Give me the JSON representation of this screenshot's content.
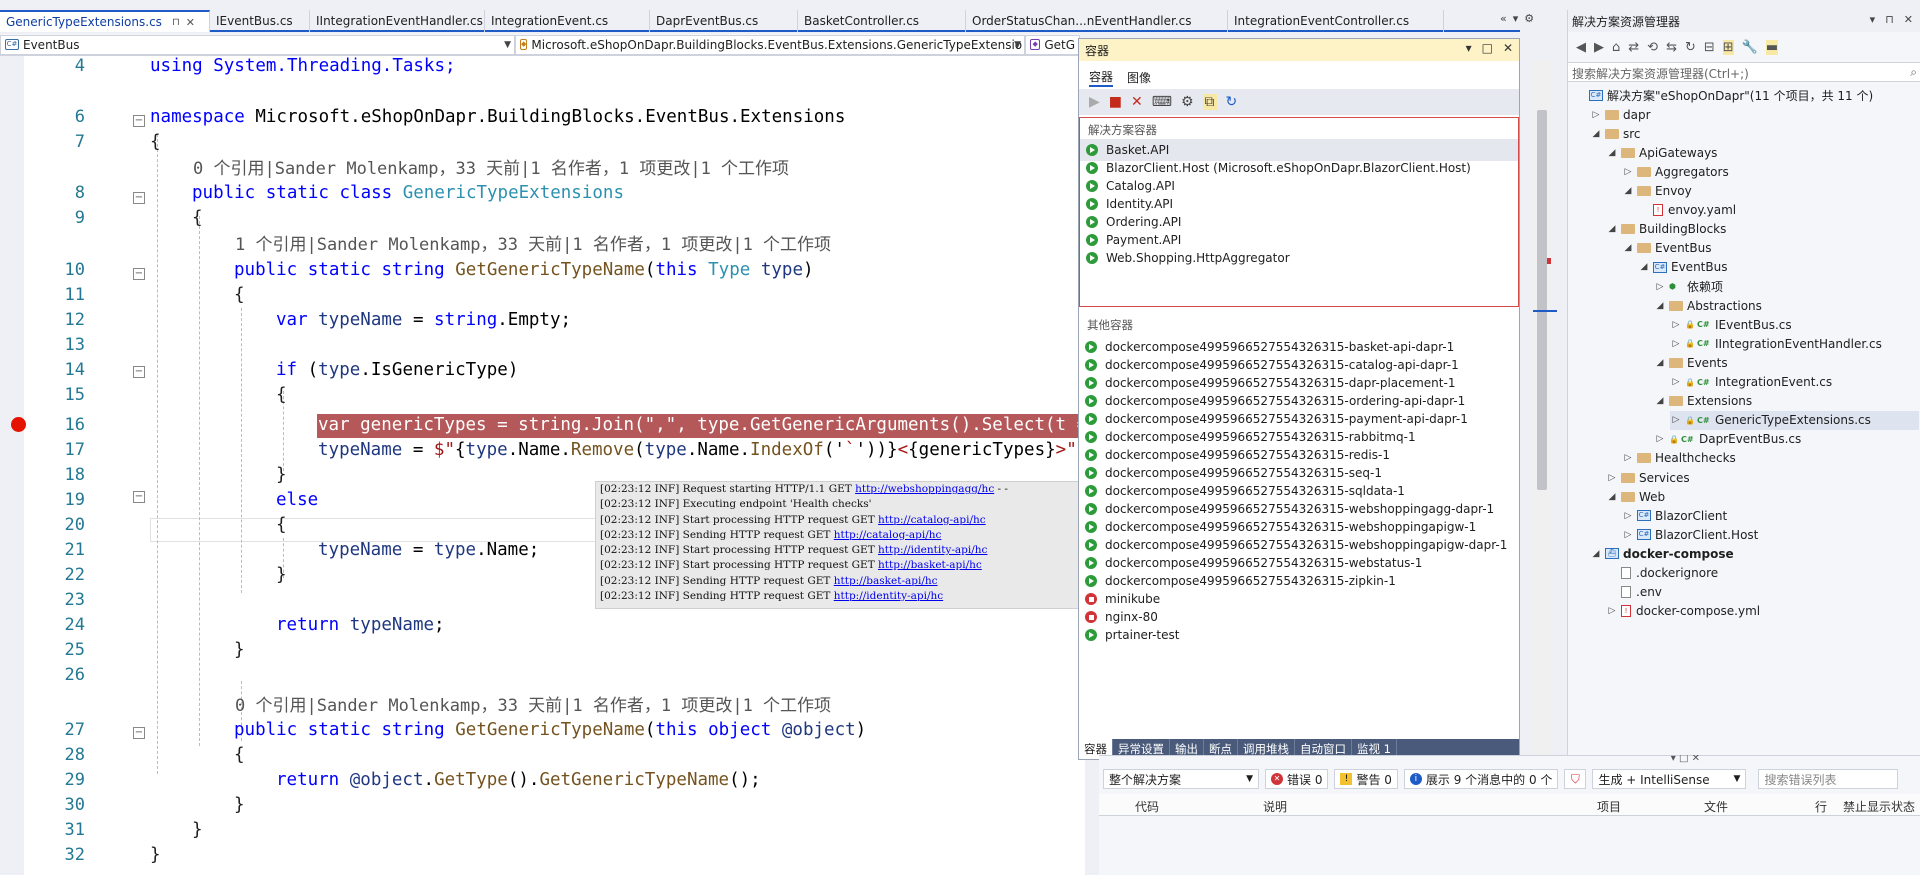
{
  "tabs": [
    {
      "label": "GenericTypeExtensions.cs",
      "active": true
    },
    {
      "label": "IEventBus.cs"
    },
    {
      "label": "IIntegrationEventHandler.cs"
    },
    {
      "label": "IntegrationEvent.cs"
    },
    {
      "label": "DaprEventBus.cs"
    },
    {
      "label": "BasketController.cs"
    },
    {
      "label": "OrderStatusChan...nEventHandler.cs"
    },
    {
      "label": "IntegrationEventController.cs"
    }
  ],
  "tab_tools": {
    "overflow": "«",
    "dropdown": "▾",
    "settings": "⚙"
  },
  "navbar": {
    "project": "EventBus",
    "type": "Microsoft.eShopOnDapr.BuildingBlocks.EventBus.Extensions.GenericTypeExtensio",
    "member": "GetG",
    "add": "+"
  },
  "editor": {
    "lines": {
      "4": "4",
      "6": "6",
      "7": "7",
      "8": "8",
      "9": "9",
      "10": "10",
      "11": "11",
      "12": "12",
      "13": "13",
      "14": "14",
      "15": "15",
      "16": "16",
      "17": "17",
      "18": "18",
      "19": "19",
      "20": "20",
      "21": "21",
      "22": "22",
      "23": "23",
      "24": "24",
      "25": "25",
      "26": "26",
      "27": "27",
      "28": "28",
      "29": "29",
      "30": "30",
      "31": "31",
      "32": "32"
    },
    "code": {
      "l4": "using System.Threading.Tasks;",
      "l6_kw": "namespace",
      "l6_rest": " Microsoft.eShopOnDapr.BuildingBlocks.EventBus.Extensions",
      "brace_open": "{",
      "brace_close": "}",
      "l8_kw": "public static class",
      "l8_ty": " GenericTypeExtensions",
      "l10_kw": "public static string",
      "l10_fn": " GetGenericTypeName",
      "l10_p1": "(",
      "l10_kw2": "this",
      "l10_ty": " Type",
      "l10_id": " type",
      "l10_p2": ")",
      "l12_kw": "var",
      "l12_id": " typeName",
      "l12_eq": " = ",
      "l12_kw2": "string",
      "l12_rest": ".Empty;",
      "l14_kw": "if",
      "l14_p1": " (",
      "l14_id": "type",
      "l14_rest": ".IsGenericType)",
      "l16": "var genericTypes = string.Join(\",\", type.GetGenericArguments().Select(t =",
      "l17_id": "typeName",
      "l17_eq": " = ",
      "l17_s1": "$\"",
      "l17_p1": "{",
      "l17_id2": "type",
      "l17_p2": ".Name.",
      "l17_fn": "Remove",
      "l17_p3": "(",
      "l17_id3": "type",
      "l17_p4": ".Name.",
      "l17_fn2": "IndexOf",
      "l17_p5": "('",
      "l17_s2": "`",
      "l17_p6": "'))}",
      "l17_s3": "<",
      "l17_p7": "{genericTypes}",
      "l17_s4": ">\";",
      "l19_kw": "else",
      "l21_id": "typeName",
      "l21_eq": " = ",
      "l21_id2": "type",
      "l21_rest": ".Name;",
      "l24_kw": "return",
      "l24_id": " typeName",
      "l24_semi": ";",
      "l27_kw": "public static string",
      "l27_fn": " GetGenericTypeName",
      "l27_p1": "(",
      "l27_kw2": "this object",
      "l27_id": " @object",
      "l27_p2": ")",
      "l29_kw": "return",
      "l29_id": " @object",
      "l29_p": ".",
      "l29_fn": "GetType",
      "l29_p2": "().",
      "l29_fn2": "GetGenericTypeName",
      "l29_p3": "();"
    },
    "codelens": {
      "class": "0 个引用|Sander Molenkamp，33 天前|1 名作者，1 项更改|1 个工作项",
      "method1": "1 个引用|Sander Molenkamp，33 天前|1 名作者，1 项更改|1 个工作项",
      "method2": "0 个引用|Sander Molenkamp，33 天前|1 名作者，1 项更改|1 个工作项"
    }
  },
  "log": [
    {
      "text": "[02:23:12 INF] Request starting HTTP/1.1 GET ",
      "link": "http://webshoppingagg/hc",
      "tail": " - -"
    },
    {
      "text": "[02:23:12 INF] Executing endpoint 'Health checks'",
      "link": "",
      "tail": ""
    },
    {
      "text": "[02:23:12 INF] Start processing HTTP request GET ",
      "link": "http://catalog-api/hc",
      "tail": ""
    },
    {
      "text": "[02:23:12 INF] Sending HTTP request GET ",
      "link": "http://catalog-api/hc",
      "tail": ""
    },
    {
      "text": "[02:23:12 INF] Start processing HTTP request GET ",
      "link": "http://identity-api/hc",
      "tail": ""
    },
    {
      "text": "[02:23:12 INF] Start processing HTTP request GET ",
      "link": "http://basket-api/hc",
      "tail": ""
    },
    {
      "text": "[02:23:12 INF] Sending HTTP request GET ",
      "link": "http://basket-api/hc",
      "tail": ""
    },
    {
      "text": "[02:23:12 INF] Sending HTTP request GET ",
      "link": "http://identity-api/hc",
      "tail": ""
    }
  ],
  "containers": {
    "title": "容器",
    "title_buttons": {
      "dropdown": "▾",
      "maximize": "□",
      "close": "✕"
    },
    "tabs": [
      "容器",
      "图像"
    ],
    "toolbar": {
      "start": "▶",
      "stop": "■",
      "delete": "✕",
      "terminal": "⌨",
      "attach": "⚙",
      "copy": "⧉",
      "refresh": "↻"
    },
    "solution_header": "解决方案容器",
    "solution_items": [
      {
        "name": "Basket.API",
        "status": "running"
      },
      {
        "name": "BlazorClient.Host (Microsoft.eShopOnDapr.BlazorClient.Host)",
        "status": "running"
      },
      {
        "name": "Catalog.API",
        "status": "running"
      },
      {
        "name": "Identity.API",
        "status": "running"
      },
      {
        "name": "Ordering.API",
        "status": "running"
      },
      {
        "name": "Payment.API",
        "status": "running"
      },
      {
        "name": "Web.Shopping.HttpAggregator",
        "status": "running"
      }
    ],
    "other_header": "其他容器",
    "other_items": [
      {
        "name": "dockercompose4995966527554326315-basket-api-dapr-1",
        "status": "running"
      },
      {
        "name": "dockercompose4995966527554326315-catalog-api-dapr-1",
        "status": "running"
      },
      {
        "name": "dockercompose4995966527554326315-dapr-placement-1",
        "status": "running"
      },
      {
        "name": "dockercompose4995966527554326315-ordering-api-dapr-1",
        "status": "running"
      },
      {
        "name": "dockercompose4995966527554326315-payment-api-dapr-1",
        "status": "running"
      },
      {
        "name": "dockercompose4995966527554326315-rabbitmq-1",
        "status": "running"
      },
      {
        "name": "dockercompose4995966527554326315-redis-1",
        "status": "running"
      },
      {
        "name": "dockercompose4995966527554326315-seq-1",
        "status": "running"
      },
      {
        "name": "dockercompose4995966527554326315-sqldata-1",
        "status": "running"
      },
      {
        "name": "dockercompose4995966527554326315-webshoppingagg-dapr-1",
        "status": "running"
      },
      {
        "name": "dockercompose4995966527554326315-webshoppingapigw-1",
        "status": "running"
      },
      {
        "name": "dockercompose4995966527554326315-webshoppingapigw-dapr-1",
        "status": "running"
      },
      {
        "name": "dockercompose4995966527554326315-webstatus-1",
        "status": "running"
      },
      {
        "name": "dockercompose4995966527554326315-zipkin-1",
        "status": "running"
      },
      {
        "name": "minikube",
        "status": "stopped"
      },
      {
        "name": "nginx-80",
        "status": "stopped"
      },
      {
        "name": "prtainer-test",
        "status": "running"
      }
    ],
    "bottom_tabs": [
      "容器",
      "异常设置",
      "输出",
      "断点",
      "调用堆栈",
      "自动窗口",
      "监视 1"
    ]
  },
  "error_list": {
    "scope": "整个解决方案",
    "errors": "错误 0",
    "warnings": "警告 0",
    "messages": "展示 9 个消息中的 0 个",
    "build": "生成 + IntelliSense",
    "search_placeholder": "搜索错误列表",
    "columns": [
      "代码",
      "说明",
      "项目",
      "文件",
      "行",
      "禁止显示状态"
    ],
    "window_buttons": "▾ □ ✕"
  },
  "solution_explorer": {
    "title": "解决方案资源管理器",
    "title_buttons": {
      "dropdown": "▾",
      "pin": "⊓",
      "close": "✕"
    },
    "search_placeholder": "搜索解决方案资源管理器(Ctrl+;)",
    "search_icon": "⌕",
    "tree": [
      {
        "label": "解决方案\"eShopOnDapr\"(11 个项目，共 11 个)",
        "level": 0,
        "kind": "solution",
        "expand": ""
      },
      {
        "label": "dapr",
        "level": 1,
        "kind": "folder",
        "expand": "▷"
      },
      {
        "label": "src",
        "level": 1,
        "kind": "folder",
        "expand": "◢"
      },
      {
        "label": "ApiGateways",
        "level": 2,
        "kind": "folder",
        "expand": "◢"
      },
      {
        "label": "Aggregators",
        "level": 3,
        "kind": "folder",
        "expand": "▷"
      },
      {
        "label": "Envoy",
        "level": 3,
        "kind": "folder",
        "expand": "◢"
      },
      {
        "label": "envoy.yaml",
        "level": 4,
        "kind": "yaml",
        "expand": ""
      },
      {
        "label": "BuildingBlocks",
        "level": 2,
        "kind": "folder",
        "expand": "◢"
      },
      {
        "label": "EventBus",
        "level": 3,
        "kind": "folder",
        "expand": "◢"
      },
      {
        "label": "EventBus",
        "level": 4,
        "kind": "project",
        "expand": "◢"
      },
      {
        "label": "依赖项",
        "level": 5,
        "kind": "deps",
        "expand": "▷"
      },
      {
        "label": "Abstractions",
        "level": 5,
        "kind": "folder",
        "expand": "◢"
      },
      {
        "label": "IEventBus.cs",
        "level": 6,
        "kind": "cs",
        "expand": "▷"
      },
      {
        "label": "IIntegrationEventHandler.cs",
        "level": 6,
        "kind": "cs",
        "expand": "▷"
      },
      {
        "label": "Events",
        "level": 5,
        "kind": "folder",
        "expand": "◢"
      },
      {
        "label": "IntegrationEvent.cs",
        "level": 6,
        "kind": "cs",
        "expand": "▷"
      },
      {
        "label": "Extensions",
        "level": 5,
        "kind": "folder",
        "expand": "◢"
      },
      {
        "label": "GenericTypeExtensions.cs",
        "level": 6,
        "kind": "cs",
        "expand": "▷",
        "selected": true
      },
      {
        "label": "DaprEventBus.cs",
        "level": 5,
        "kind": "cs",
        "expand": "▷"
      },
      {
        "label": "Healthchecks",
        "level": 3,
        "kind": "folder",
        "expand": "▷"
      },
      {
        "label": "Services",
        "level": 2,
        "kind": "folder",
        "expand": "▷"
      },
      {
        "label": "Web",
        "level": 2,
        "kind": "folder",
        "expand": "◢"
      },
      {
        "label": "BlazorClient",
        "level": 3,
        "kind": "project",
        "expand": "▷"
      },
      {
        "label": "BlazorClient.Host",
        "level": 3,
        "kind": "project",
        "expand": "▷"
      },
      {
        "label": "docker-compose",
        "level": 1,
        "kind": "compose",
        "expand": "◢",
        "bold": true
      },
      {
        "label": ".dockerignore",
        "level": 2,
        "kind": "file",
        "expand": ""
      },
      {
        "label": ".env",
        "level": 2,
        "kind": "file",
        "expand": ""
      },
      {
        "label": "docker-compose.yml",
        "level": 2,
        "kind": "yaml",
        "expand": "▷"
      }
    ]
  },
  "colors": {
    "accent": "#1e5bc6",
    "breakpoint": "#e51400",
    "running": "#2e9b3a",
    "stopped": "#d13438",
    "highlight": "#b5585a"
  }
}
